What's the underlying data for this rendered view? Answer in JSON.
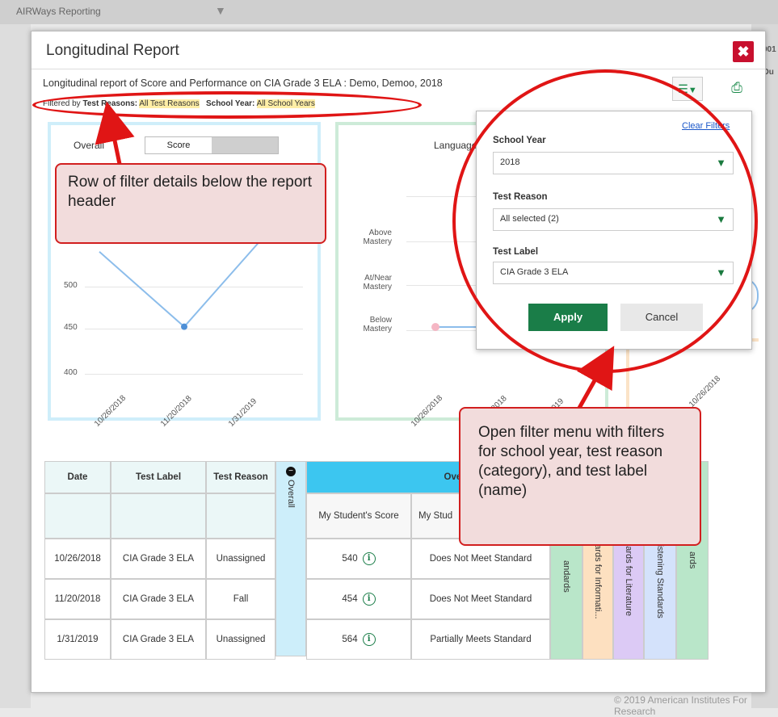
{
  "app": {
    "title": "AIRWays Reporting",
    "right_text_1": "901",
    "right_text_2": "Ou",
    "footer": "© 2019 American Institutes For Research"
  },
  "modal": {
    "title": "Longitudinal Report",
    "description": "Longitudinal report of Score and Performance on CIA Grade 3 ELA : Demo, Demoo, 2018",
    "filter_prefix": "Filtered by",
    "filter_reason_label": "Test Reasons:",
    "filter_reason_value": "All Test Reasons",
    "filter_year_label": "School Year:",
    "filter_year_value": "All School Years"
  },
  "chart1": {
    "title": "Overall",
    "toggle_label": "Score",
    "y_ticks": [
      "500",
      "450",
      "400"
    ],
    "x_ticks": [
      "10/26/2018",
      "11/20/2018",
      "1/31/2019"
    ]
  },
  "chart2": {
    "title": "Language",
    "levels": [
      "Above\nMastery",
      "At/Near\nMastery",
      "Below\nMastery"
    ],
    "x_ticks": [
      "10/26/2018",
      "11/20/2018",
      "1/31/2019"
    ]
  },
  "chart3": {
    "x_tick": "10/26/2018"
  },
  "chart_data": {
    "type": "line",
    "title": "Overall",
    "x": [
      "10/26/2018",
      "11/20/2018",
      "1/31/2019"
    ],
    "values": [
      540,
      454,
      564
    ],
    "ylim": [
      400,
      560
    ]
  },
  "filter_menu": {
    "clear_label": "Clear Filters",
    "school_year_label": "School Year",
    "school_year_value": "2018",
    "test_reason_label": "Test Reason",
    "test_reason_value": "All selected (2)",
    "test_label_label": "Test Label",
    "test_label_value": "CIA Grade 3 ELA",
    "apply": "Apply",
    "cancel": "Cancel"
  },
  "table": {
    "headers": {
      "date": "Date",
      "test_label": "Test Label",
      "test_reason": "Test Reason",
      "overall_collapsed": "Overall",
      "overall_group": "Overall",
      "my_score": "My Student's Score",
      "my_level": "My Stud"
    },
    "side_columns": [
      "andards",
      "ndards for Informati...",
      "ndards for Literature",
      "l Listening Standards",
      "ards"
    ],
    "side_colors": [
      "#b9e6c9",
      "#fde0c0",
      "#dccaf5",
      "#d4e2fb",
      "#b9e6c9"
    ],
    "rows": [
      {
        "date": "10/26/2018",
        "label": "CIA Grade 3 ELA",
        "reason": "Unassigned",
        "score": "540",
        "level": "Does Not Meet Standard"
      },
      {
        "date": "11/20/2018",
        "label": "CIA Grade 3 ELA",
        "reason": "Fall",
        "score": "454",
        "level": "Does Not Meet Standard"
      },
      {
        "date": "1/31/2019",
        "label": "CIA Grade 3 ELA",
        "reason": "Unassigned",
        "score": "564",
        "level": "Partially Meets Standard"
      }
    ]
  },
  "annotations": {
    "callout_filter_row": "Row of filter details below the report header",
    "callout_filter_menu": "Open filter menu with filters for school year, test reason (category), and test label (name)"
  }
}
